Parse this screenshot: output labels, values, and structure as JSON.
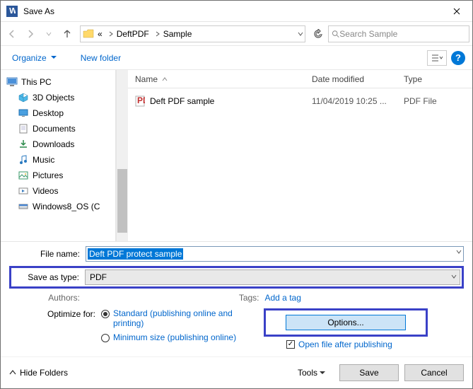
{
  "title": "Save As",
  "breadcrumbs": {
    "root": "«",
    "p1": "DeftPDF",
    "p2": "Sample"
  },
  "search_placeholder": "Search Sample",
  "toolbar": {
    "organize": "Organize",
    "newfolder": "New folder"
  },
  "columns": {
    "name": "Name",
    "date": "Date modified",
    "type": "Type"
  },
  "tree": {
    "thispc": "This PC",
    "objects3d": "3D Objects",
    "desktop": "Desktop",
    "documents": "Documents",
    "downloads": "Downloads",
    "music": "Music",
    "pictures": "Pictures",
    "videos": "Videos",
    "drive": "Windows8_OS (C"
  },
  "files": [
    {
      "name": "Deft PDF sample",
      "date": "11/04/2019 10:25 ...",
      "type": "PDF File"
    }
  ],
  "labels": {
    "filename": "File name:",
    "savetype": "Save as type:",
    "authors": "Authors:",
    "tags": "Tags:",
    "addtag": "Add a tag",
    "optimize": "Optimize for:",
    "radio1": "Standard (publishing online and printing)",
    "radio2": "Minimum size (publishing online)",
    "options": "Options...",
    "openafter": "Open file after publishing",
    "hide": "Hide Folders",
    "tools": "Tools",
    "save": "Save",
    "cancel": "Cancel"
  },
  "values": {
    "filename": "Deft PDF protect sample",
    "savetype": "PDF"
  }
}
